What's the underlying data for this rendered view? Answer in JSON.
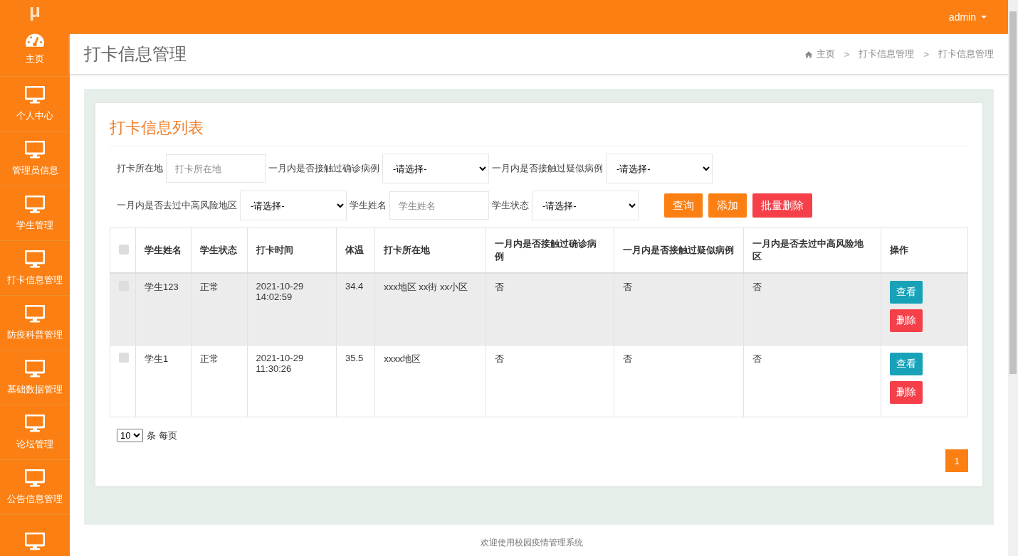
{
  "logo": "μ",
  "user_menu": {
    "label": "admin"
  },
  "sidebar": {
    "items": [
      {
        "label": "主页",
        "kind": "dashboard",
        "selected": false
      },
      {
        "label": "个人中心",
        "kind": "screen",
        "selected": false
      },
      {
        "label": "管理员信息",
        "kind": "screen",
        "selected": false
      },
      {
        "label": "学生管理",
        "kind": "screen",
        "selected": false
      },
      {
        "label": "打卡信息管理",
        "kind": "screen",
        "selected": false
      },
      {
        "label": "防疫科普管理",
        "kind": "screen",
        "selected": false
      },
      {
        "label": "基础数据管理",
        "kind": "screen",
        "selected": false
      },
      {
        "label": "论坛管理",
        "kind": "screen",
        "selected": false
      },
      {
        "label": "公告信息管理",
        "kind": "screen",
        "selected": false
      },
      {
        "kind": "screen",
        "selected": false
      }
    ]
  },
  "page_title": "打卡信息管理",
  "breadcrumb": [
    {
      "label": "主页"
    },
    {
      "separator": ">",
      "label": "打卡信息管理"
    },
    {
      "separator": ">",
      "label": "打卡信息管理"
    }
  ],
  "card_title": "打卡信息列表",
  "filters": [
    {
      "kind": "text",
      "label": "打卡所在地",
      "placeholder": "打卡所在地"
    },
    {
      "kind": "select",
      "label": "一月内是否接触过确诊病例",
      "value": "-请选择-"
    },
    {
      "kind": "select",
      "label": "一月内是否接触过疑似病例",
      "value": "-请选择-"
    },
    {
      "kind": "break"
    },
    {
      "kind": "select",
      "label": "一月内是否去过中高风险地区",
      "value": "-请选择-"
    },
    {
      "kind": "text",
      "label": "学生姓名",
      "placeholder": "学生姓名"
    },
    {
      "kind": "select",
      "label": "学生状态",
      "value": "-请选择-"
    }
  ],
  "actions": [
    {
      "label": "查询",
      "kind": "orange"
    },
    {
      "label": "添加",
      "kind": "orange"
    },
    {
      "label": "批量删除",
      "kind": "red"
    }
  ],
  "table": {
    "select_all_checked": false,
    "columns": [
      "学生姓名",
      "学生状态",
      "打卡时间",
      "体温",
      "打卡所在地",
      "一月内是否接触过确诊病例",
      "一月内是否接触过疑似病例",
      "一月内是否去过中高风险地区",
      "操作"
    ],
    "rows": [
      {
        "checked": false,
        "hovered": true,
        "cells": [
          "学生123",
          "正常",
          "2021-10-29 14:02:59",
          "34.4",
          "xxx地区 xx街 xx小区",
          "否",
          "否",
          "否"
        ],
        "buttons": [
          {
            "label": "查看",
            "kind": "view"
          },
          {
            "label": "删除",
            "kind": "delete"
          }
        ]
      },
      {
        "checked": false,
        "hovered": false,
        "cells": [
          "学生1",
          "正常",
          "2021-10-29 11:30:26",
          "35.5",
          "xxxx地区",
          "否",
          "否",
          "否"
        ],
        "buttons": [
          {
            "label": "查看",
            "kind": "view"
          },
          {
            "label": "删除",
            "kind": "delete"
          }
        ]
      }
    ]
  },
  "page_size": {
    "value": "10",
    "label": "条 每页"
  },
  "pagination": [
    {
      "label": "1",
      "selected": true
    }
  ],
  "footer": "欢迎使用校园疫情管理系统"
}
